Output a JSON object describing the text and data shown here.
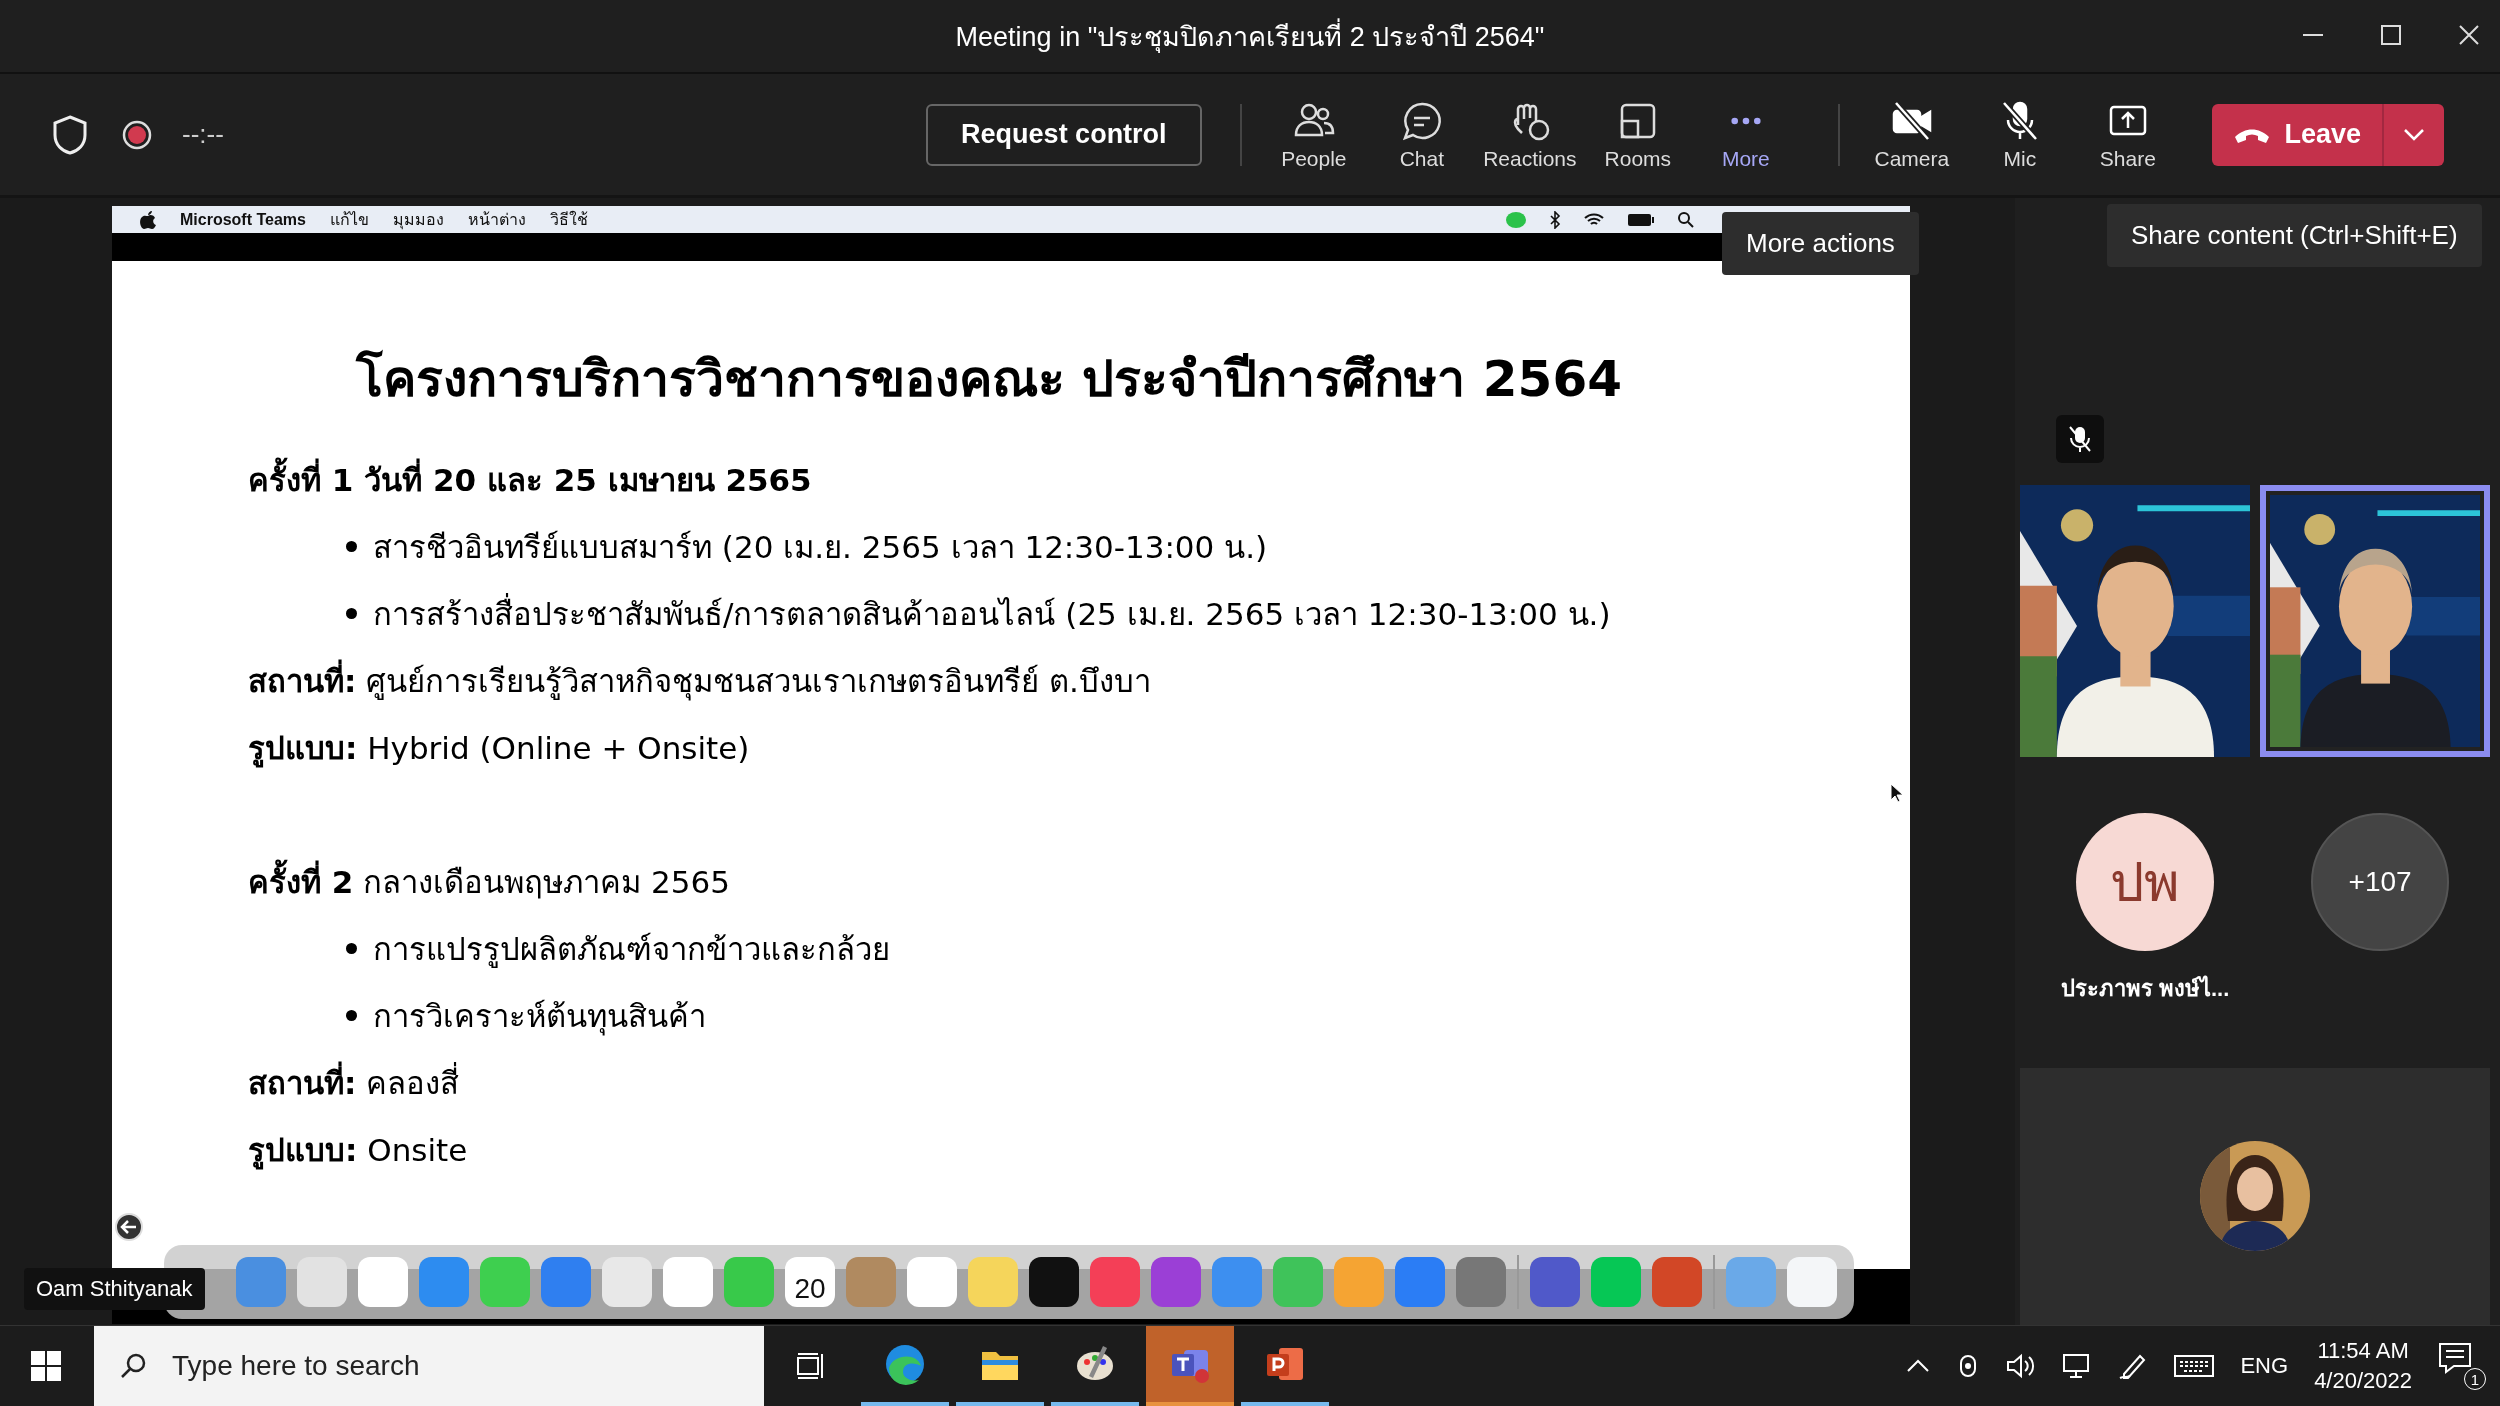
{
  "window": {
    "title": "Meeting in \"ประชุมปิดภาคเรียนที่ 2 ประจำปี 2564\""
  },
  "toolbar": {
    "timer": "--:--",
    "request_control": "Request control",
    "actions": [
      {
        "kind": "people",
        "label": "People",
        "selected": false
      },
      {
        "kind": "chat",
        "label": "Chat",
        "selected": false
      },
      {
        "kind": "reactions",
        "label": "Reactions",
        "selected": false
      },
      {
        "kind": "rooms",
        "label": "Rooms",
        "selected": false
      },
      {
        "kind": "more",
        "label": "More",
        "selected": true
      }
    ],
    "devices": [
      {
        "kind": "camera",
        "label": "Camera",
        "off": true
      },
      {
        "kind": "mic",
        "label": "Mic",
        "off": true
      },
      {
        "kind": "share",
        "label": "Share",
        "off": false
      }
    ],
    "leave": "Leave"
  },
  "tooltips": [
    "More actions",
    "Share content (Ctrl+Shift+E)"
  ],
  "shared_screen": {
    "menu_bar": [
      "Microsoft Teams",
      "แก้ไข",
      "มุมมอง",
      "หน้าต่าง",
      "วิธีใช้"
    ],
    "slide": {
      "title": "โครงการบริการวิชาการของคณะ ประจำปีการศึกษา 2564",
      "lines": [
        {
          "kind": "heading",
          "text": "ครั้งที่ 1 วันที่ 20 และ 25 เมษายน 2565"
        },
        {
          "kind": "bullet",
          "text": "สารชีวอินทรีย์แบบสมาร์ท (20 เม.ย. 2565 เวลา 12:30-13:00 น.)"
        },
        {
          "kind": "bullet",
          "text": "การสร้างสื่อประชาสัมพันธ์/การตลาดสินค้าออนไลน์ (25 เม.ย. 2565 เวลา 12:30-13:00 น.)"
        },
        {
          "kind": "field",
          "text": "**สถานที่:** ศูนย์การเรียนรู้วิสาหกิจชุมชนสวนเราเกษตรอินทรีย์ ต.บึงบา"
        },
        {
          "kind": "field",
          "text": "**รูปแบบ:** Hybrid (Online + Onsite)"
        },
        {
          "kind": "heading_gap",
          "text": "**ครั้งที่ 2** กลางเดือนพฤษภาคม 2565"
        },
        {
          "kind": "bullet",
          "text": "การแปรรูปผลิตภัณฑ์จากข้าวและกล้วย"
        },
        {
          "kind": "bullet",
          "text": "การวิเคราะห์ต้นทุนสินค้า"
        },
        {
          "kind": "field",
          "text": "**สถานที่:** คลองสี่"
        },
        {
          "kind": "field",
          "text": "**รูปแบบ:** Onsite"
        }
      ]
    },
    "dock_calendar_day": "20",
    "presenter": "Oam Sthityanak"
  },
  "participants": {
    "videos": [
      {
        "kind": "picture",
        "speaking": false
      },
      {
        "kind": "picture",
        "speaking": true
      }
    ],
    "avatar": {
      "initials": "ปพ",
      "name": "ประภาพร พงษ์ไ..."
    },
    "overflow": "+107"
  },
  "taskbar": {
    "search_placeholder": "Type here to search",
    "apps": [
      {
        "kind": "edge",
        "running": true,
        "active": false
      },
      {
        "kind": "folder",
        "running": true,
        "active": false
      },
      {
        "kind": "paint",
        "running": true,
        "active": false
      },
      {
        "kind": "teams",
        "running": true,
        "active": true
      },
      {
        "kind": "powerpoint",
        "running": true,
        "active": false
      }
    ],
    "language": "ENG",
    "time": "11:54 AM",
    "date": "4/20/2022",
    "notifications": "1"
  }
}
